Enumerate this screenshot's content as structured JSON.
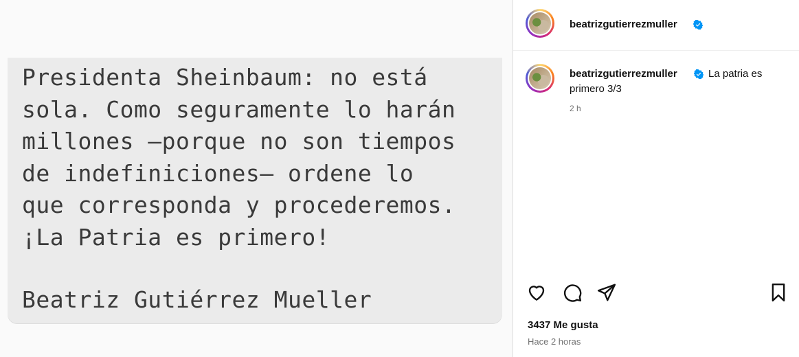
{
  "post_image": {
    "message": "Presidenta Sheinbaum: no está\nsola. Como seguramente lo harán\nmillones —porque no son tiempos\nde indefiniciones— ordene lo\nque corresponda y procederemos.\n¡La Patria es primero!",
    "signature": "Beatriz Gutiérrez Mueller"
  },
  "header": {
    "username": "beatrizgutierrezmuller"
  },
  "caption": {
    "username": "beatrizgutierrezmuller",
    "text_line1": "La patria es",
    "text_line2": "primero 3/3",
    "time": "2 h"
  },
  "actions": {
    "like_icon": "heart-icon",
    "comment_icon": "comment-icon",
    "share_icon": "share-icon",
    "save_icon": "bookmark-icon"
  },
  "stats": {
    "likes": "3437 Me gusta",
    "posted": "Hace 2 horas"
  },
  "colors": {
    "verified": "#0095f6",
    "text": "#111111",
    "muted": "#737373"
  }
}
